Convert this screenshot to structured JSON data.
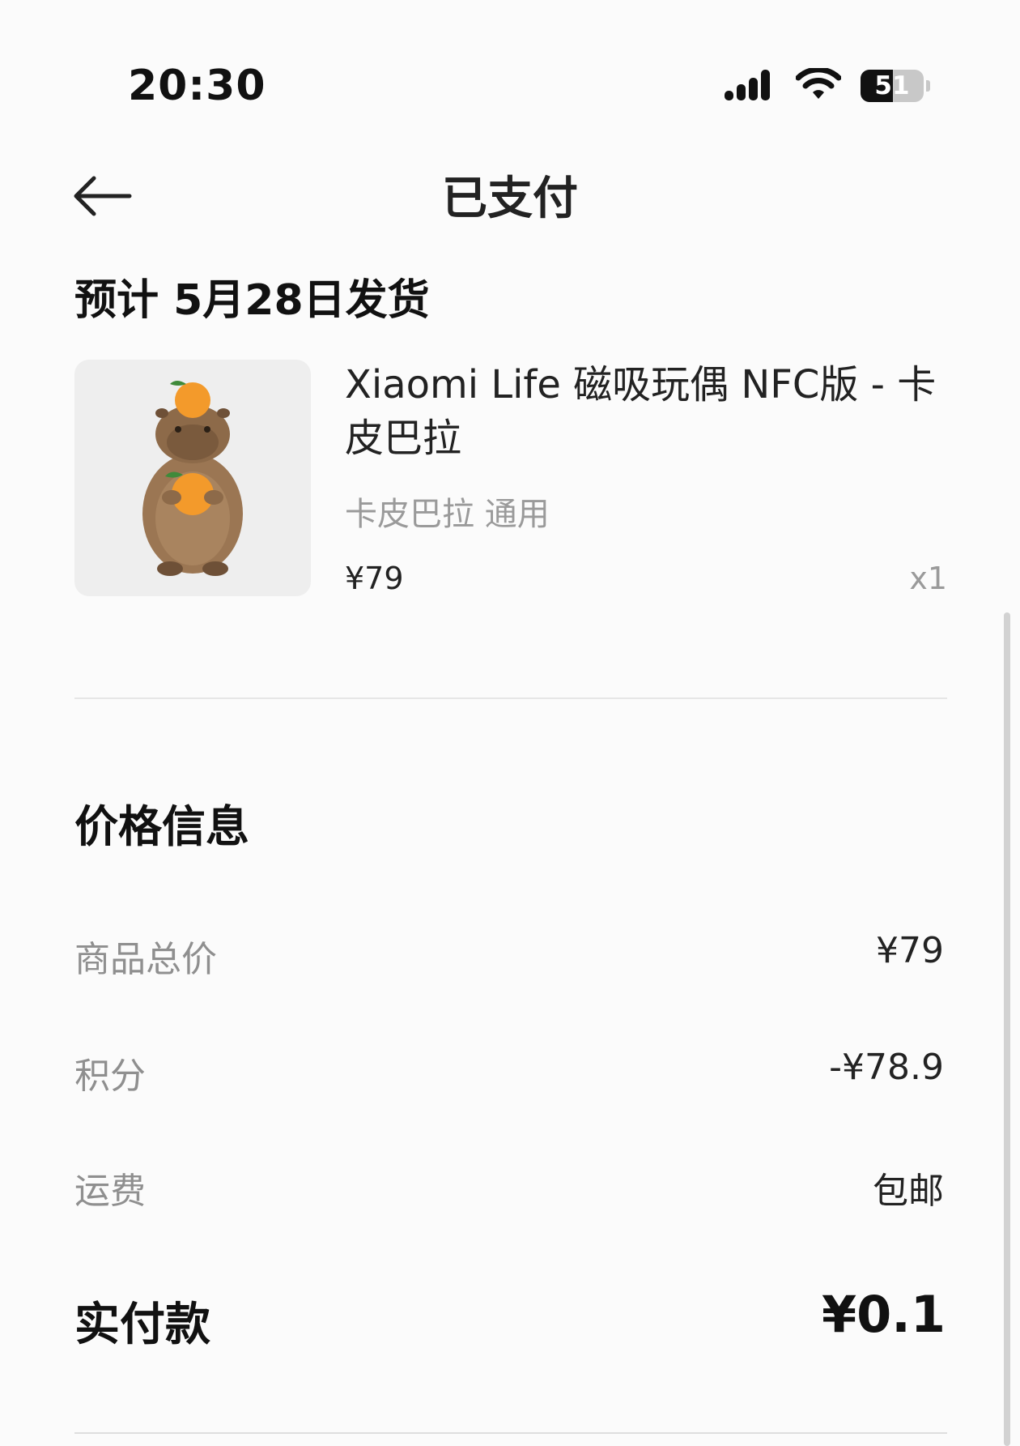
{
  "status_bar": {
    "time": "20:30",
    "battery_level": 51,
    "battery_text": "51",
    "icons": [
      "signal-icon",
      "wifi-icon",
      "battery-icon"
    ]
  },
  "header": {
    "title": "已支付",
    "back_icon": "arrow-left-icon"
  },
  "shipping": {
    "text": "预计 5月28日发货"
  },
  "product": {
    "name": "Xiaomi Life 磁吸玩偶 NFC版 - 卡皮巴拉",
    "variant": "卡皮巴拉 通用",
    "price": "¥79",
    "quantity": "x1",
    "image_icon": "capybara-plush-with-oranges"
  },
  "price_info": {
    "title": "价格信息",
    "rows": [
      {
        "label": "商品总价",
        "value": "¥79"
      },
      {
        "label": "积分",
        "value": "-¥78.9"
      },
      {
        "label": "运费",
        "value": "包邮"
      }
    ],
    "total_label": "实付款",
    "total_value": "¥0.1"
  },
  "colors": {
    "background": "#fbfbfb",
    "primary_text": "#111111",
    "secondary_text": "#8f8f8f",
    "thumb_background": "#eeeeee",
    "orange": "#f39a2b"
  }
}
